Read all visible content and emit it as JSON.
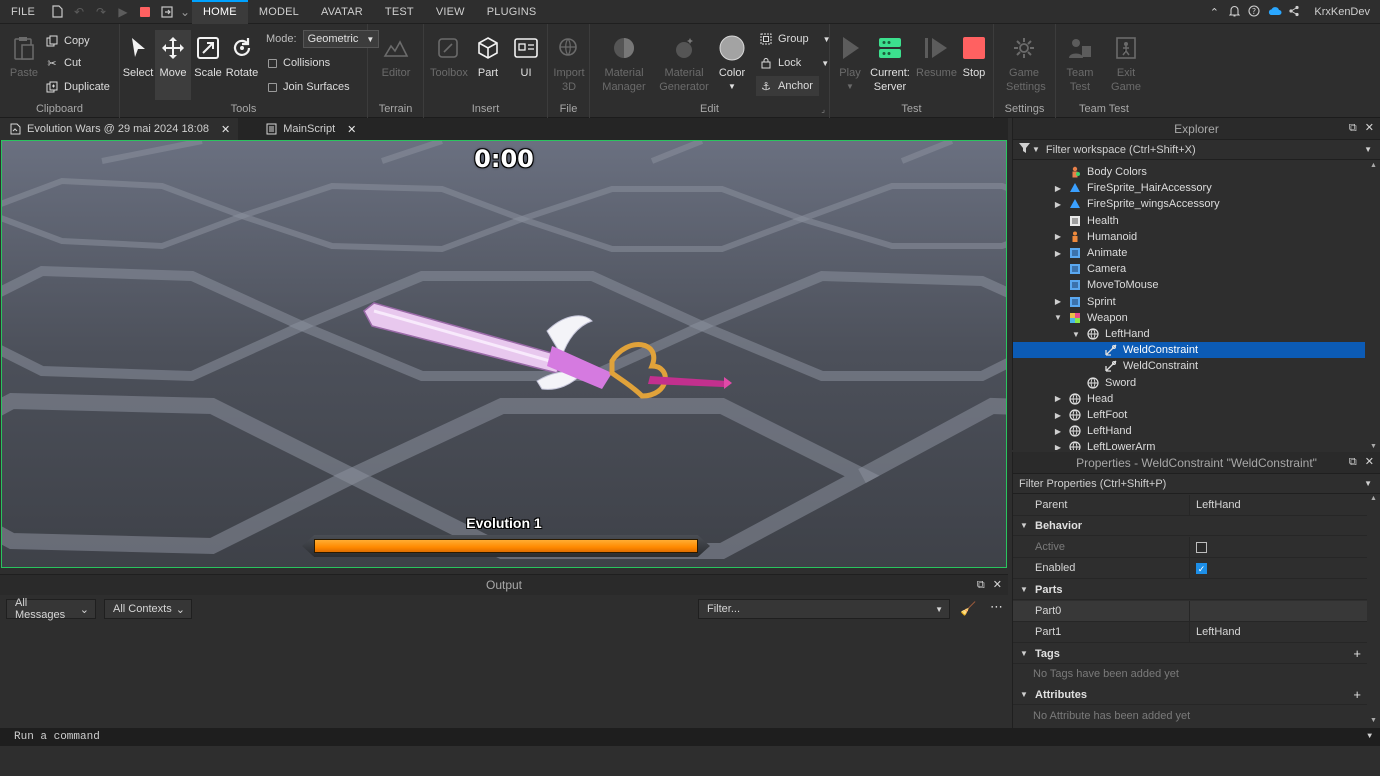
{
  "menubar": {
    "file": "FILE",
    "tabs": [
      "HOME",
      "MODEL",
      "AVATAR",
      "TEST",
      "VIEW",
      "PLUGINS"
    ],
    "active_tab": "HOME",
    "username": "KrxKenDev"
  },
  "ribbon": {
    "clipboard": {
      "label": "Clipboard",
      "paste": "Paste",
      "copy": "Copy",
      "cut": "Cut",
      "duplicate": "Duplicate"
    },
    "tools": {
      "label": "Tools",
      "select": "Select",
      "move": "Move",
      "scale": "Scale",
      "rotate": "Rotate",
      "mode_label": "Mode:",
      "mode_value": "Geometric",
      "collisions": "Collisions",
      "join_surfaces": "Join Surfaces"
    },
    "terrain": {
      "label": "Terrain",
      "editor": "Editor"
    },
    "insert": {
      "label": "Insert",
      "toolbox": "Toolbox",
      "part": "Part",
      "ui": "UI"
    },
    "file": {
      "label": "File",
      "import3d_line1": "Import",
      "import3d_line2": "3D"
    },
    "edit": {
      "label": "Edit",
      "material_manager_1": "Material",
      "material_manager_2": "Manager",
      "material_generator_1": "Material",
      "material_generator_2": "Generator",
      "color": "Color",
      "group": "Group",
      "lock": "Lock",
      "anchor": "Anchor"
    },
    "test": {
      "label": "Test",
      "play": "Play",
      "current_server_1": "Current:",
      "current_server_2": "Server",
      "resume": "Resume",
      "stop": "Stop"
    },
    "settings": {
      "label": "Settings",
      "game_settings_1": "Game",
      "game_settings_2": "Settings"
    },
    "team_test": {
      "label": "Team Test",
      "team_test_1": "Team",
      "team_test_2": "Test",
      "exit_game_1": "Exit",
      "exit_game_2": "Game"
    }
  },
  "doc_tabs": [
    {
      "label": "Evolution Wars @ 29 mai 2024 18:08",
      "active": true
    },
    {
      "label": "MainScript",
      "active": false
    }
  ],
  "viewport": {
    "timer": "0:00",
    "evolution_label": "Evolution 1",
    "evolution_progress": 1.0
  },
  "output": {
    "title": "Output",
    "messages_filter": "All Messages",
    "contexts_filter": "All Contexts",
    "filter_placeholder": "Filter..."
  },
  "command_bar": {
    "placeholder": "Run a command"
  },
  "explorer": {
    "title": "Explorer",
    "filter_placeholder": "Filter workspace (Ctrl+Shift+X)",
    "items": [
      {
        "label": "Body Colors",
        "depth": 0,
        "arrow": "",
        "icon": "body-colors-icon"
      },
      {
        "label": "FireSprite_HairAccessory",
        "depth": 0,
        "arrow": "collapsed",
        "icon": "accessory-icon"
      },
      {
        "label": "FireSprite_wingsAccessory",
        "depth": 0,
        "arrow": "collapsed",
        "icon": "accessory-icon"
      },
      {
        "label": "Health",
        "depth": 0,
        "arrow": "",
        "icon": "script-icon"
      },
      {
        "label": "Humanoid",
        "depth": 0,
        "arrow": "collapsed",
        "icon": "humanoid-icon"
      },
      {
        "label": "Animate",
        "depth": 0,
        "arrow": "collapsed",
        "icon": "localscript-icon"
      },
      {
        "label": "Camera",
        "depth": 0,
        "arrow": "",
        "icon": "localscript-icon"
      },
      {
        "label": "MoveToMouse",
        "depth": 0,
        "arrow": "",
        "icon": "localscript-icon"
      },
      {
        "label": "Sprint",
        "depth": 0,
        "arrow": "collapsed",
        "icon": "localscript-icon"
      },
      {
        "label": "Weapon",
        "depth": 0,
        "arrow": "expanded",
        "icon": "model-icon"
      },
      {
        "label": "LeftHand",
        "depth": 1,
        "arrow": "expanded",
        "icon": "meshpart-icon"
      },
      {
        "label": "WeldConstraint",
        "depth": 2,
        "arrow": "",
        "icon": "weld-icon",
        "selected": true
      },
      {
        "label": "WeldConstraint",
        "depth": 2,
        "arrow": "",
        "icon": "weld-icon"
      },
      {
        "label": "Sword",
        "depth": 1,
        "arrow": "",
        "icon": "meshpart-icon"
      },
      {
        "label": "Head",
        "depth": 0,
        "arrow": "collapsed",
        "icon": "meshpart-icon"
      },
      {
        "label": "LeftFoot",
        "depth": 0,
        "arrow": "collapsed",
        "icon": "meshpart-icon"
      },
      {
        "label": "LeftHand",
        "depth": 0,
        "arrow": "collapsed",
        "icon": "meshpart-icon"
      },
      {
        "label": "LeftLowerArm",
        "depth": 0,
        "arrow": "collapsed",
        "icon": "meshpart-icon"
      }
    ]
  },
  "properties": {
    "title": "Properties - WeldConstraint \"WeldConstraint\"",
    "filter_placeholder": "Filter Properties (Ctrl+Shift+P)",
    "parent_label": "Parent",
    "parent_value": "LeftHand",
    "behavior_label": "Behavior",
    "active_label": "Active",
    "active_checked": false,
    "enabled_label": "Enabled",
    "enabled_checked": true,
    "parts_label": "Parts",
    "part0_label": "Part0",
    "part0_value": "",
    "part1_label": "Part1",
    "part1_value": "LeftHand",
    "tags_label": "Tags",
    "tags_empty": "No Tags have been added yet",
    "attributes_label": "Attributes",
    "attributes_empty": "No Attribute has been added yet"
  },
  "colors": {
    "accent": "#00a2ff",
    "selection": "#0c5bb5",
    "viewport_border": "#29c45e",
    "stop_red": "#ff6161",
    "server_green": "#3ce08e",
    "progress_orange": "#ff8a00"
  }
}
